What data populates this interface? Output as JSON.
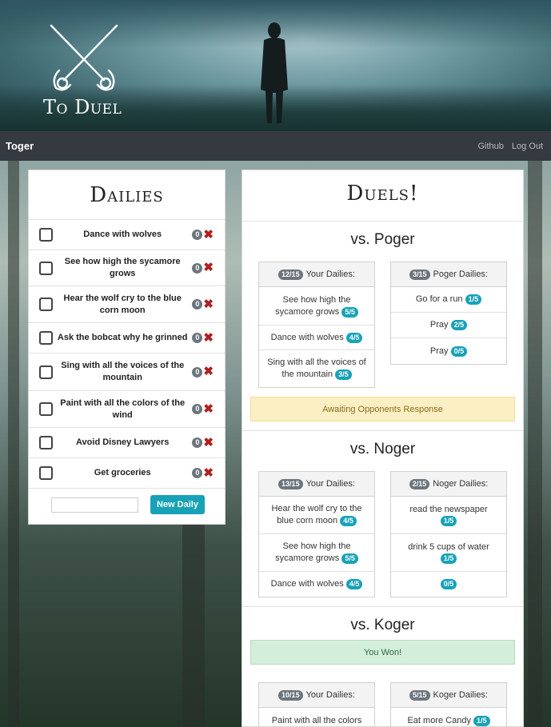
{
  "app": {
    "logo_text": "To Duel"
  },
  "nav": {
    "brand": "Toger",
    "links": [
      "Github",
      "Log Out"
    ]
  },
  "dailies": {
    "title": "Dailies",
    "items": [
      {
        "text": "Dance with wolves",
        "count": "0"
      },
      {
        "text": "See how high the sycamore grows",
        "count": "0"
      },
      {
        "text": "Hear the wolf cry to the blue corn moon",
        "count": "0"
      },
      {
        "text": "Ask the bobcat why he grinned",
        "count": "0"
      },
      {
        "text": "Sing with all the voices of the mountain",
        "count": "0"
      },
      {
        "text": "Paint with all the colors of the wind",
        "count": "0"
      },
      {
        "text": "Avoid Disney Lawyers",
        "count": "0"
      },
      {
        "text": "Get groceries",
        "count": "0"
      }
    ],
    "new_input_placeholder": "",
    "new_button": "New Daily",
    "delete_icon": "x-icon",
    "delete_color": "#b21e1e"
  },
  "duels": {
    "title": "Duels!",
    "sections": [
      {
        "opponent": "vs. Poger",
        "your_score": "12/15",
        "your_label": "Your Dailies:",
        "your_items": [
          {
            "text": "See how high the sycamore grows",
            "badge": "5/5"
          },
          {
            "text": "Dance with wolves",
            "badge": "4/5"
          },
          {
            "text": "Sing with all the voices of the mountain",
            "badge": "3/5"
          }
        ],
        "opp_score": "3/15",
        "opp_label": "Poger Dailies:",
        "opp_items": [
          {
            "text": "Go for a run",
            "badge": "1/5"
          },
          {
            "text": "Pray",
            "badge": "2/5"
          },
          {
            "text": "Pray",
            "badge": "0/5"
          }
        ],
        "status": "Awaiting Opponents Response",
        "status_type": "warning"
      },
      {
        "opponent": "vs. Noger",
        "your_score": "13/15",
        "your_label": "Your Dailies:",
        "your_items": [
          {
            "text": "Hear the wolf cry to the blue corn moon",
            "badge": "4/5"
          },
          {
            "text": "See how high the sycamore grows",
            "badge": "5/5"
          },
          {
            "text": "Dance with wolves",
            "badge": "4/5"
          }
        ],
        "opp_score": "2/15",
        "opp_label": "Noger Dailies:",
        "opp_items": [
          {
            "text": "read the newspaper",
            "badge": "1/5"
          },
          {
            "text": "drink 5 cups of water",
            "badge": "1/5"
          },
          {
            "text": "",
            "badge": "0/5"
          }
        ]
      },
      {
        "opponent": "vs. Koger",
        "status": "You Won!",
        "status_type": "success",
        "your_score": "10/15",
        "your_label": "Your Dailies:",
        "your_items": [
          {
            "text": "Paint with all the colors",
            "badge": ""
          }
        ],
        "opp_score": "5/15",
        "opp_label": "Koger Dailies:",
        "opp_items": [
          {
            "text": "Eat more Candy",
            "badge": "1/5"
          }
        ]
      }
    ]
  },
  "colors": {
    "navbar": "#343a40",
    "accent": "#17a2b8",
    "badge_gray": "#6c757d"
  }
}
